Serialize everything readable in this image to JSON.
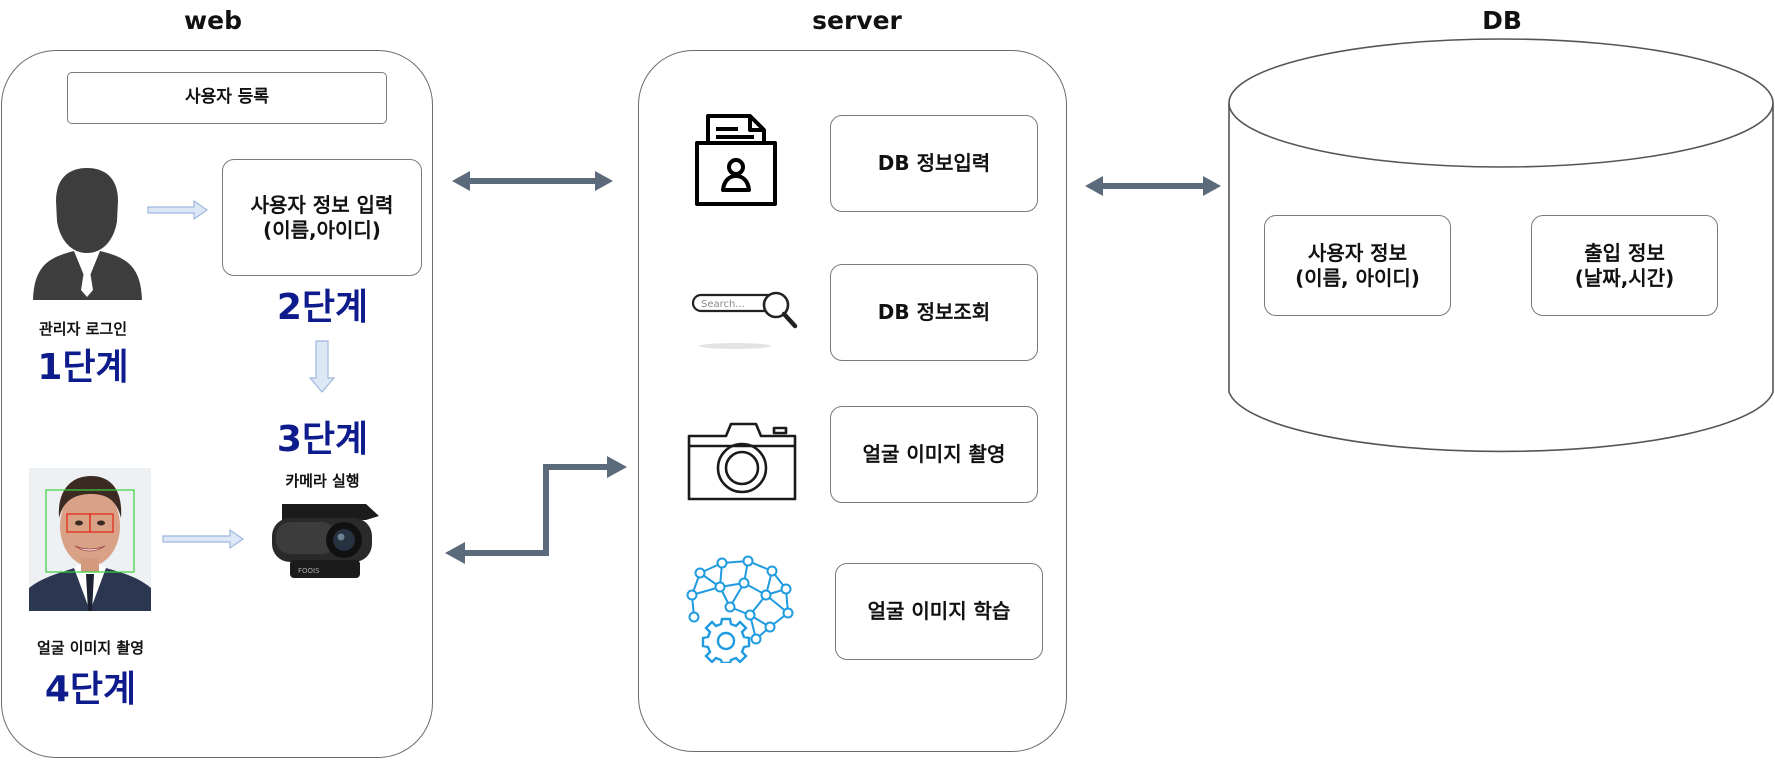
{
  "columns": {
    "web": "web",
    "server": "server",
    "db": "DB"
  },
  "web": {
    "register_title": "사용자 등록",
    "user_info_input": "사용자 정보 입력\n(이름,아이디)",
    "admin_login_caption": "관리자 로그인",
    "step1": "1단계",
    "step2": "2단계",
    "step3": "3단계",
    "camera_caption": "카메라 실행",
    "face_caption": "얼굴 이미지 촬영",
    "step4": "4단계",
    "webcam_brand": "FOOIS"
  },
  "server": {
    "db_input": "DB 정보입력",
    "search_placeholder": "Search...",
    "db_query": "DB 정보조회",
    "face_capture": "얼굴 이미지 촬영",
    "face_train": "얼굴 이미지 학습"
  },
  "db": {
    "user_info": "사용자 정보\n(이름, 아이디)",
    "access_info": "출입 정보\n(날짜,시간)"
  },
  "colors": {
    "step_blue": "#0e1b8c",
    "arrow_gray": "#5b6b7c",
    "light_arrow": "#c9d8ef",
    "icon_blue": "#1f9be0"
  }
}
